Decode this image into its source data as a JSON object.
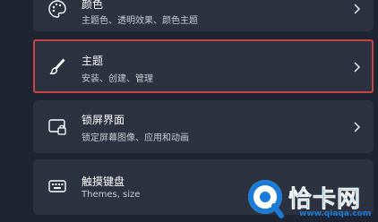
{
  "settings": {
    "items": [
      {
        "title": "颜色",
        "subtitle": "主题色、透明效果、颜色主题",
        "icon": "palette-icon"
      },
      {
        "title": "主题",
        "subtitle": "安装、创建、管理",
        "icon": "brush-icon",
        "highlighted": true
      },
      {
        "title": "锁屏界面",
        "subtitle": "锁定屏幕图像、应用和动画",
        "icon": "lock-screen-icon"
      },
      {
        "title": "触摸键盘",
        "subtitle": "Themes, size",
        "icon": "keyboard-icon"
      }
    ]
  },
  "watermark": {
    "brand": "恰卡网",
    "url": "www.qiaqa.com"
  },
  "colors": {
    "background": "#1f2432",
    "card": "#2d3240",
    "highlight_border": "#c64648",
    "subtitle_text": "#c9ccd3",
    "watermark_blue": "#1b7bd6"
  }
}
